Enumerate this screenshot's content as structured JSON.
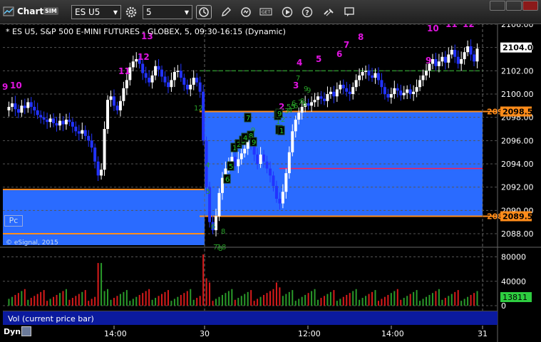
{
  "toolbar": {
    "app_title": "Chart",
    "sim_badge": "SIM",
    "symbol_value": "ES U5",
    "interval_value": "5"
  },
  "chart": {
    "header": "* ES U5, S&P 500 E-MINI FUTURES - GLOBEX, 5, 09:30-16:15 (Dynamic)",
    "copyright": "© eSignal, 2015",
    "pc_label": "Pc",
    "price_ticks": [
      "2106.00",
      "2104.00",
      "2102.00",
      "2100.00",
      "2098.00",
      "2096.00",
      "2094.00",
      "2092.00",
      "2090.00",
      "2088.00"
    ],
    "time_ticks": [
      "14:00",
      "30",
      "12:00",
      "14:00",
      "31"
    ],
    "price_flags": {
      "last": "2104.00",
      "upper_level": "2098.50",
      "lower_level": "2089.50",
      "upper_level_cut": "209",
      "lower_level_cut": "208"
    },
    "volume_ticks": [
      "80000",
      "40000",
      "0"
    ],
    "volume_flag": "13811",
    "study_name": "Vol (current price bar)",
    "bottom_label": "Dyn",
    "td_counts": {
      "magenta": [
        "9",
        "10",
        "11",
        "12",
        "13",
        "2",
        "3",
        "4",
        "5",
        "6",
        "7",
        "8",
        "9",
        "10",
        "11",
        "12"
      ],
      "green": [
        "12",
        "4",
        "5",
        "6",
        "8",
        "7",
        "8",
        "9",
        "7",
        "5",
        "6",
        "8",
        "9",
        "1",
        "2",
        "3",
        "4",
        "5",
        "6",
        "7",
        "8",
        "9",
        "7",
        "8"
      ],
      "black_boxes": [
        "7",
        "8",
        "9",
        "1",
        "2",
        "3",
        "4",
        "5",
        "6",
        "7",
        "8",
        "9",
        "1"
      ]
    }
  },
  "colors": {
    "up_bar": "#ffffff",
    "down_bar": "#2233ff",
    "zone_fill": "#2a6bff",
    "level_line": "#ff8c1a",
    "mid_line": "#ff2050",
    "prior_high": "#2a8a2a",
    "volume_up": "#2a9a2a",
    "volume_down": "#d81b1b",
    "td_setup": "#e014e0",
    "td_countdown": "#28a028"
  }
}
